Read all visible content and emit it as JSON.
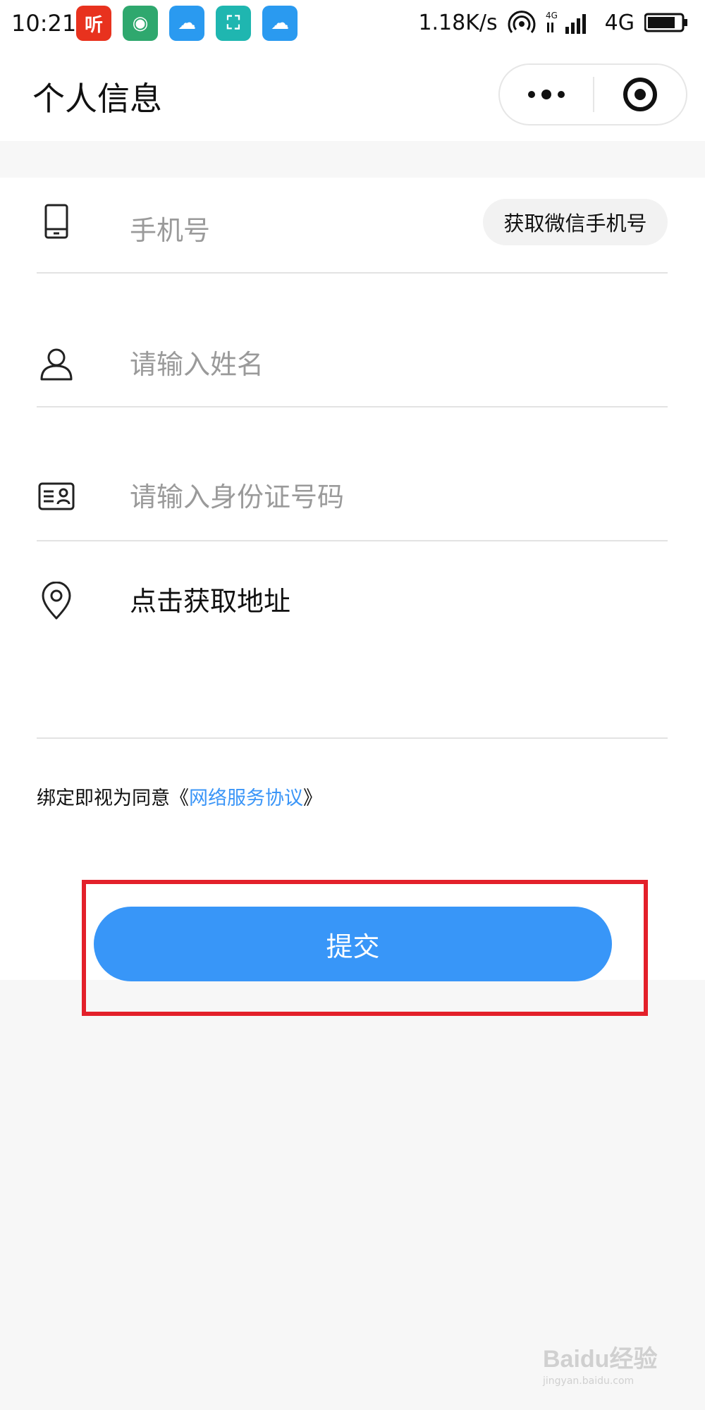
{
  "status_bar": {
    "time": "10:21",
    "app_icons": [
      {
        "name": "ting-app-icon",
        "glyph": "听",
        "color": "#e8321e"
      },
      {
        "name": "signal-app-icon",
        "glyph": "◉",
        "color": "#2fa86e"
      },
      {
        "name": "weather-app-icon",
        "glyph": "☁",
        "color": "#2a9af0"
      },
      {
        "name": "scan-app-icon",
        "glyph": "⛶",
        "color": "#1fb6b0"
      },
      {
        "name": "weather-app-icon-2",
        "glyph": "☁",
        "color": "#2a9af0"
      }
    ],
    "speed": "1.18K/s",
    "network": "4G"
  },
  "nav": {
    "title": "个人信息"
  },
  "form": {
    "phone": {
      "placeholder": "手机号",
      "icon": "phone-icon"
    },
    "wechat_phone_button": "获取微信手机号",
    "name": {
      "placeholder": "请输入姓名",
      "icon": "person-icon"
    },
    "id_card": {
      "placeholder": "请输入身份证号码",
      "icon": "id-card-icon"
    },
    "address": {
      "label": "点击获取地址",
      "icon": "location-pin-icon"
    },
    "agreement_prefix": "绑定即视为同意《",
    "agreement_link": "网络服务协议",
    "agreement_suffix": "》",
    "submit_label": "提交"
  },
  "colors": {
    "accent": "#3896f8",
    "link": "#3a95f7",
    "highlight": "#e3202a"
  },
  "watermark": {
    "text": "Baidu经验",
    "sub": "jingyan.baidu.com"
  }
}
